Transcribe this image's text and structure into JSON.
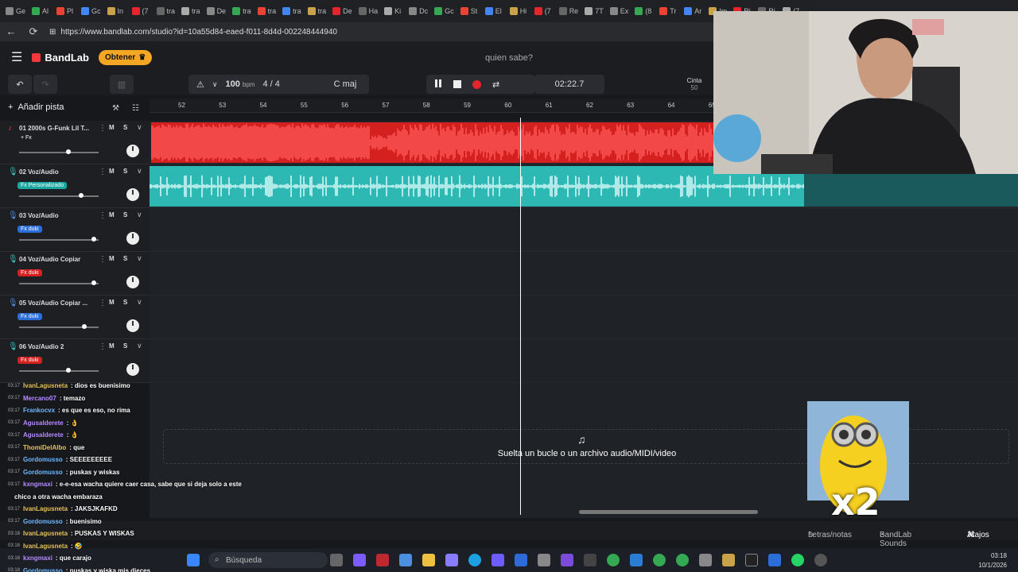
{
  "browser": {
    "tabs": [
      "Ge",
      "Al",
      "Pl",
      "Gc",
      "In",
      "(7",
      "tra",
      "tra",
      "De",
      "tra",
      "tra",
      "tra",
      "tra",
      "De",
      "Ha",
      "Ki",
      "Dc",
      "Gc",
      "St",
      "El",
      "Hi",
      "(7",
      "Re",
      "7T",
      "Ex",
      "(8",
      "Tr",
      "Ar",
      "Im",
      "Ri",
      "Ri",
      "(7"
    ],
    "url": "https://www.bandlab.com/studio?id=10a55d84-eaed-f011-8d4d-002248444940"
  },
  "app": {
    "brand": "BandLab",
    "obtener_label": "Obtener",
    "song_title": "quien sabe?",
    "colors": {
      "accent": "#f2383d",
      "obtener": "#f5a623",
      "red_clip": "#d52020",
      "teal_clip": "#2db8b4"
    }
  },
  "transport": {
    "tempo": "100",
    "tempo_unit": "bpm",
    "time_signature": "4 / 4",
    "key": "C maj",
    "time": "02:22.7",
    "tape_label": "Cinta",
    "tape_value": "50"
  },
  "toolbar": {
    "add_track": "Añadir pista"
  },
  "ruler": [
    "52",
    "53",
    "54",
    "55",
    "56",
    "57",
    "58",
    "59",
    "60",
    "61",
    "62",
    "63",
    "64",
    "65"
  ],
  "tracks": [
    {
      "number": "01",
      "name": "2000s G-Funk Lil T...",
      "fx": "+ Fx",
      "fx_color": "none",
      "type": "instrument",
      "volume": 0.62
    },
    {
      "number": "02",
      "name": "Voz/Audio",
      "fx": "Fx Personalizado",
      "fx_color": "#1aa7a0",
      "type": "mic",
      "volume": 0.78
    },
    {
      "number": "03",
      "name": "Voz/Audio",
      "fx": "Fx duki",
      "fx_color": "#2b6ed9",
      "type": "mic",
      "volume": 0.94
    },
    {
      "number": "04",
      "name": "Voz/Audio Copiar",
      "fx": "Fx duki",
      "fx_color": "#d52020",
      "type": "mic",
      "volume": 0.94
    },
    {
      "number": "05",
      "name": "Voz/Audio Copiar ...",
      "fx": "Fx duki",
      "fx_color": "#2b6ed9",
      "type": "mic",
      "volume": 0.82
    },
    {
      "number": "06",
      "name": "Voz/Audio 2",
      "fx": "Fx duki",
      "fx_color": "#d52020",
      "type": "mic",
      "volume": 0.62
    }
  ],
  "drop_zone": {
    "text": "Suelta un bucle o un archivo audio/MIDI/video"
  },
  "footer": {
    "lyrics": "Letras/notas",
    "sounds": "BandLab Sounds",
    "shortcuts": "Atajos"
  },
  "taskbar": {
    "search_placeholder": "Búsqueda",
    "time": "03:18",
    "date": "10/1/2026"
  },
  "chat": [
    {
      "ts": "03:17",
      "user": "IvanLagusneta",
      "color": "gold",
      "text": ": dios es buenisimo"
    },
    {
      "ts": "03:17",
      "user": "Mercano07",
      "color": "purple",
      "text": ": temazo"
    },
    {
      "ts": "03:17",
      "user": "Frankocvx",
      "color": "blue",
      "text": ": es que es eso, no rima"
    },
    {
      "ts": "03:17",
      "user": "Agusalderete",
      "color": "purple",
      "text": ": 👌"
    },
    {
      "ts": "03:17",
      "user": "Agusalderete",
      "color": "purple",
      "text": ": 👌"
    },
    {
      "ts": "03:17",
      "user": "ThomiDelAlbo",
      "color": "gold",
      "text": ": que"
    },
    {
      "ts": "03:17",
      "user": "Gordomusso",
      "color": "blue",
      "text": ": SEEEEEEEEE"
    },
    {
      "ts": "03:17",
      "user": "Gordomusso",
      "color": "blue",
      "text": ": puskas y wiskas"
    },
    {
      "ts": "03:17",
      "user": "kxngmaxi",
      "color": "purple",
      "text": ": e-e-esa wacha quiere caer casa, sabe que si deja solo a este"
    },
    {
      "ts": "",
      "user": "",
      "color": "blue",
      "text": "chico a otra wacha embaraza"
    },
    {
      "ts": "03:17",
      "user": "IvanLagusneta",
      "color": "gold",
      "text": ": JAKSJKAFKD"
    },
    {
      "ts": "03:17",
      "user": "Gordomusso",
      "color": "blue",
      "text": ": buenisimo"
    },
    {
      "ts": "03:18",
      "user": "IvanLagusneta",
      "color": "gold",
      "text": ": PUSKAS Y WISKAS"
    },
    {
      "ts": "03:18",
      "user": "IvanLagusneta",
      "color": "gold",
      "text": ": 🤣"
    },
    {
      "ts": "03:18",
      "user": "kxngmaxi",
      "color": "purple",
      "text": ": que carajo"
    },
    {
      "ts": "03:18",
      "user": "Gordomusso",
      "color": "blue",
      "text": ": puskas y wiska mis dieces"
    }
  ],
  "sticker": {
    "text": "x2"
  }
}
